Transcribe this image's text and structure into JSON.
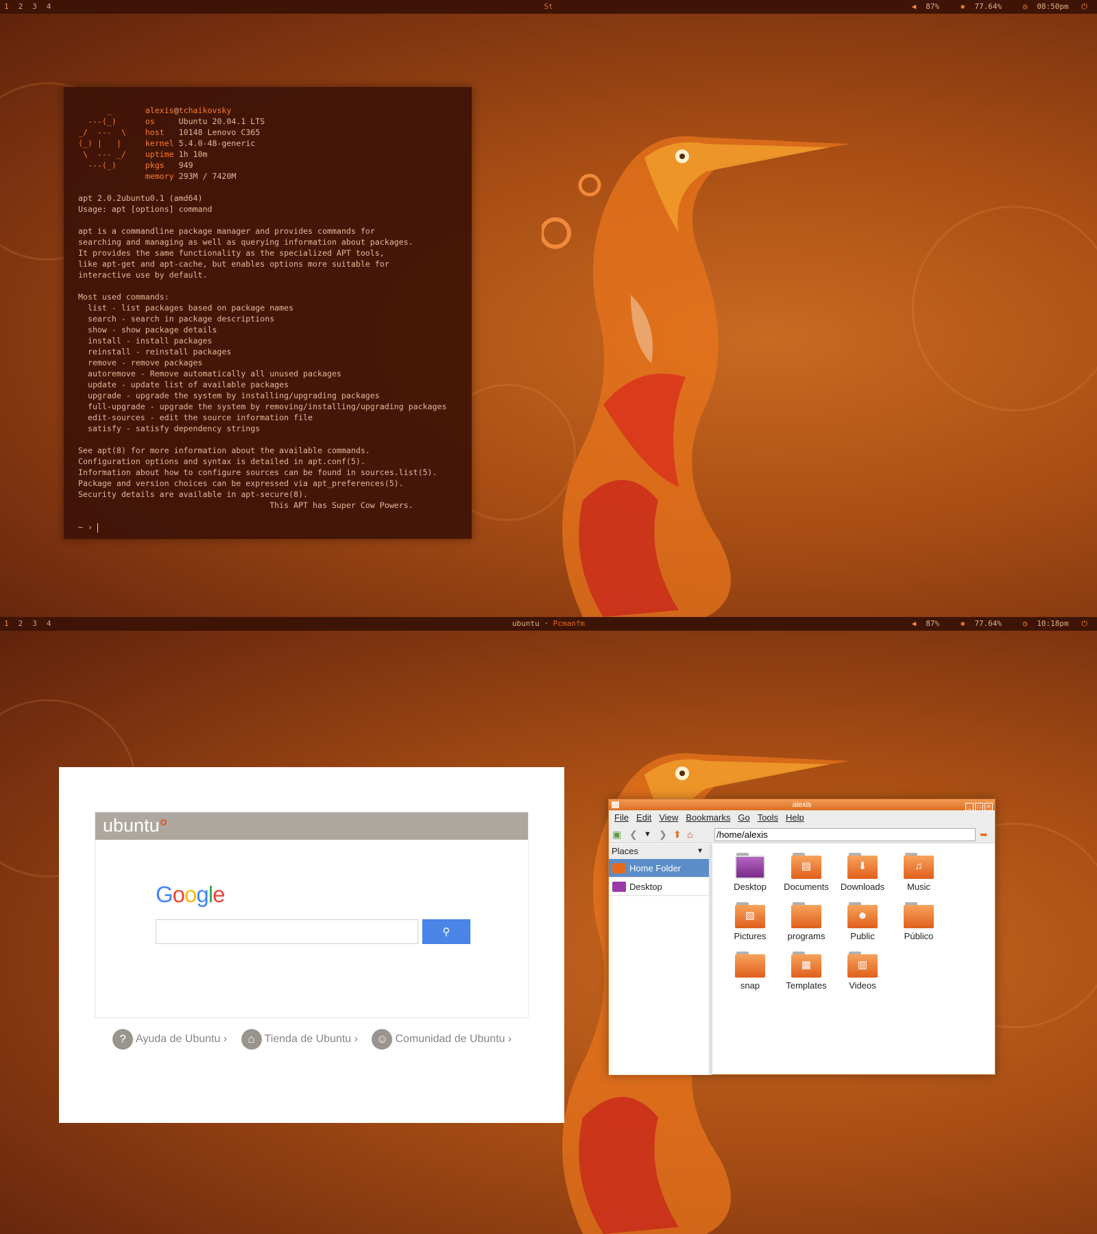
{
  "colors": {
    "accent": "#e95420",
    "bar_bg": "#3d1405",
    "google_blue": "#4a86e8"
  },
  "screen1": {
    "bar": {
      "workspaces": [
        "1",
        "2",
        "3",
        "4"
      ],
      "active_workspace": "1",
      "window_title": "St",
      "volume": "87%",
      "brightness": "77.64%",
      "clock": "08:50pm"
    }
  },
  "terminal": {
    "ascii_art": [
      "      _",
      "  ---(_)",
      "_/  ---  \\",
      "(_) |   |",
      " \\  --- _/",
      "  ---(_)"
    ],
    "user": "alexis",
    "at": "@",
    "host_name": "tchaikovsky",
    "info": [
      {
        "k": "os",
        "v": "Ubuntu 20.04.1 LTS"
      },
      {
        "k": "host",
        "v": "10148 Lenovo C365"
      },
      {
        "k": "kernel",
        "v": "5.4.0-48-generic"
      },
      {
        "k": "uptime",
        "v": "1h 10m"
      },
      {
        "k": "pkgs",
        "v": "949"
      },
      {
        "k": "memory",
        "v": "293M / 7420M"
      }
    ],
    "output": [
      "apt 2.0.2ubuntu0.1 (amd64)",
      "Usage: apt [options] command",
      "",
      "apt is a commandline package manager and provides commands for",
      "searching and managing as well as querying information about packages.",
      "It provides the same functionality as the specialized APT tools,",
      "like apt-get and apt-cache, but enables options more suitable for",
      "interactive use by default.",
      "",
      "Most used commands:",
      "  list - list packages based on package names",
      "  search - search in package descriptions",
      "  show - show package details",
      "  install - install packages",
      "  reinstall - reinstall packages",
      "  remove - remove packages",
      "  autoremove - Remove automatically all unused packages",
      "  update - update list of available packages",
      "  upgrade - upgrade the system by installing/upgrading packages",
      "  full-upgrade - upgrade the system by removing/installing/upgrading packages",
      "  edit-sources - edit the source information file",
      "  satisfy - satisfy dependency strings",
      "",
      "See apt(8) for more information about the available commands.",
      "Configuration options and syntax is detailed in apt.conf(5).",
      "Information about how to configure sources can be found in sources.list(5).",
      "Package and version choices can be expressed via apt_preferences(5).",
      "Security details are available in apt-secure(8).",
      "                                        This APT has Super Cow Powers."
    ],
    "prompt": "~ › "
  },
  "screen2": {
    "bar": {
      "workspaces": [
        "1",
        "2",
        "3",
        "4"
      ],
      "active_workspace": "1",
      "window_title_host": "ubuntu",
      "separator": "·",
      "window_title_app": "Pcmanfm",
      "volume": "87%",
      "brightness": "77.64%",
      "clock": "10:18pm"
    }
  },
  "browser": {
    "ubuntu_logo": "ubuntu",
    "google_logo": [
      "G",
      "o",
      "o",
      "g",
      "l",
      "e"
    ],
    "google_colors": [
      "#4285f4",
      "#ea4335",
      "#fbbc05",
      "#4285f4",
      "#34a853",
      "#ea4335"
    ],
    "search_value": "",
    "links": [
      {
        "label": "Ayuda de Ubuntu ›",
        "icon": "help-icon"
      },
      {
        "label": "Tienda de Ubuntu ›",
        "icon": "shop-icon"
      },
      {
        "label": "Comunidad de Ubuntu ›",
        "icon": "community-icon"
      }
    ]
  },
  "filemanager": {
    "title": "alexis",
    "menu": [
      "File",
      "Edit",
      "View",
      "Bookmarks",
      "Go",
      "Tools",
      "Help"
    ],
    "path": "/home/alexis",
    "places_label": "Places",
    "places": [
      {
        "label": "Home Folder",
        "selected": true
      },
      {
        "label": "Desktop",
        "selected": false
      }
    ],
    "items": [
      {
        "label": "Desktop",
        "icon": "desktop-folder-icon"
      },
      {
        "label": "Documents",
        "icon": "documents-folder-icon"
      },
      {
        "label": "Downloads",
        "icon": "downloads-folder-icon"
      },
      {
        "label": "Music",
        "icon": "music-folder-icon"
      },
      {
        "label": "Pictures",
        "icon": "pictures-folder-icon"
      },
      {
        "label": "programs",
        "icon": "folder-icon"
      },
      {
        "label": "Public",
        "icon": "public-folder-icon"
      },
      {
        "label": "Público",
        "icon": "folder-icon"
      },
      {
        "label": "snap",
        "icon": "folder-icon"
      },
      {
        "label": "Templates",
        "icon": "templates-folder-icon"
      },
      {
        "label": "Videos",
        "icon": "videos-folder-icon"
      }
    ]
  }
}
